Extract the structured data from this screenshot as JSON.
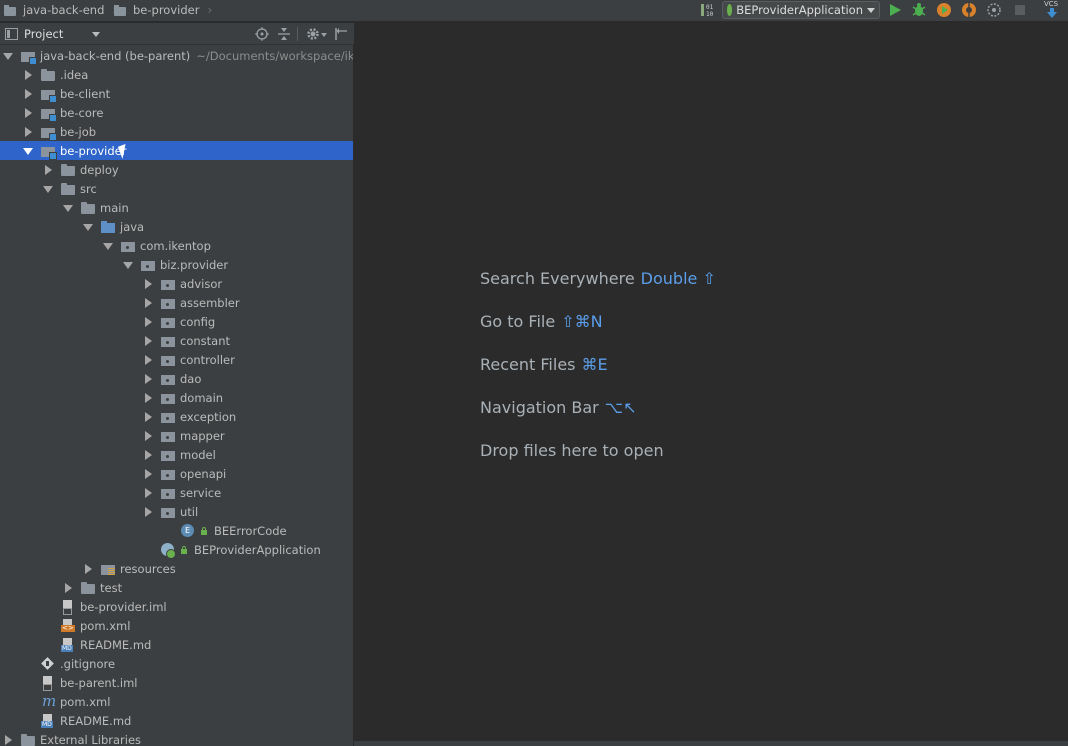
{
  "breadcrumbs": [
    "java-back-end",
    "be-provider"
  ],
  "run_config": {
    "label": "BEProviderApplication"
  },
  "toolbar": {
    "vcs_label": "VCS",
    "icons": [
      "run-icon",
      "debug-icon",
      "coverage-icon",
      "profile-icon",
      "attach-icon",
      "stop-icon",
      "vcs-update-icon"
    ]
  },
  "project_panel": {
    "title": "Project",
    "tree": [
      {
        "label": "java-back-end (be-parent)",
        "detail": "~/Documents/workspace/ikentop/java-back-end",
        "icon": "module",
        "depth": 0,
        "toggle": "down"
      },
      {
        "label": ".idea",
        "icon": "folder",
        "depth": 1,
        "toggle": "right"
      },
      {
        "label": "be-client",
        "icon": "module",
        "depth": 1,
        "toggle": "right"
      },
      {
        "label": "be-core",
        "icon": "module",
        "depth": 1,
        "toggle": "right"
      },
      {
        "label": "be-job",
        "icon": "module",
        "depth": 1,
        "toggle": "right"
      },
      {
        "label": "be-provider",
        "icon": "module",
        "depth": 1,
        "toggle": "down",
        "selected": true
      },
      {
        "label": "deploy",
        "icon": "folder",
        "depth": 2,
        "toggle": "right"
      },
      {
        "label": "src",
        "icon": "folder",
        "depth": 2,
        "toggle": "down"
      },
      {
        "label": "main",
        "icon": "folder",
        "depth": 3,
        "toggle": "down"
      },
      {
        "label": "java",
        "icon": "src",
        "depth": 4,
        "toggle": "down"
      },
      {
        "label": "com.ikentop",
        "icon": "pkg",
        "depth": 5,
        "toggle": "down"
      },
      {
        "label": "biz.provider",
        "icon": "pkg",
        "depth": 6,
        "toggle": "down"
      },
      {
        "label": "advisor",
        "icon": "pkg",
        "depth": 7,
        "toggle": "right"
      },
      {
        "label": "assembler",
        "icon": "pkg",
        "depth": 7,
        "toggle": "right"
      },
      {
        "label": "config",
        "icon": "pkg",
        "depth": 7,
        "toggle": "right"
      },
      {
        "label": "constant",
        "icon": "pkg",
        "depth": 7,
        "toggle": "right"
      },
      {
        "label": "controller",
        "icon": "pkg",
        "depth": 7,
        "toggle": "right"
      },
      {
        "label": "dao",
        "icon": "pkg",
        "depth": 7,
        "toggle": "right"
      },
      {
        "label": "domain",
        "icon": "pkg",
        "depth": 7,
        "toggle": "right"
      },
      {
        "label": "exception",
        "icon": "pkg",
        "depth": 7,
        "toggle": "right"
      },
      {
        "label": "mapper",
        "icon": "pkg",
        "depth": 7,
        "toggle": "right"
      },
      {
        "label": "model",
        "icon": "pkg",
        "depth": 7,
        "toggle": "right"
      },
      {
        "label": "openapi",
        "icon": "pkg",
        "depth": 7,
        "toggle": "right"
      },
      {
        "label": "service",
        "icon": "pkg",
        "depth": 7,
        "toggle": "right"
      },
      {
        "label": "util",
        "icon": "pkg",
        "depth": 7,
        "toggle": "right"
      },
      {
        "label": "BEErrorCode",
        "icon": "enum",
        "depth": 8,
        "toggle": "none",
        "lock": true
      },
      {
        "label": "BEProviderApplication",
        "icon": "springcls",
        "depth": 7,
        "toggle": "none",
        "lock": true
      },
      {
        "label": "resources",
        "icon": "res",
        "depth": 4,
        "toggle": "right"
      },
      {
        "label": "test",
        "icon": "folder",
        "depth": 3,
        "toggle": "right"
      },
      {
        "label": "be-provider.iml",
        "icon": "file",
        "depth": 2,
        "toggle": "none"
      },
      {
        "label": "pom.xml",
        "icon": "xml",
        "depth": 2,
        "toggle": "none"
      },
      {
        "label": "README.md",
        "icon": "md",
        "depth": 2,
        "toggle": "none"
      },
      {
        "label": ".gitignore",
        "icon": "git",
        "depth": 1,
        "toggle": "none"
      },
      {
        "label": "be-parent.iml",
        "icon": "file",
        "depth": 1,
        "toggle": "none"
      },
      {
        "label": "pom.xml",
        "icon": "mvn",
        "depth": 1,
        "toggle": "none"
      },
      {
        "label": "README.md",
        "icon": "md",
        "depth": 1,
        "toggle": "none"
      },
      {
        "label": "External Libraries",
        "icon": "folder",
        "depth": 0,
        "toggle": "right"
      }
    ]
  },
  "editor_hints": [
    {
      "text": "Search Everywhere",
      "key": "Double ⇧"
    },
    {
      "text": "Go to File",
      "key": "⇧⌘N"
    },
    {
      "text": "Recent Files",
      "key": "⌘E"
    },
    {
      "text": "Navigation Bar",
      "key": "⌥↖"
    },
    {
      "text": "Drop files here to open",
      "key": ""
    }
  ],
  "colors": {
    "background": "#2b2b2b",
    "panel": "#3c3f41",
    "selection": "#2f65ca",
    "shortcut": "#5b9ee9",
    "run_green": "#4caf50"
  }
}
